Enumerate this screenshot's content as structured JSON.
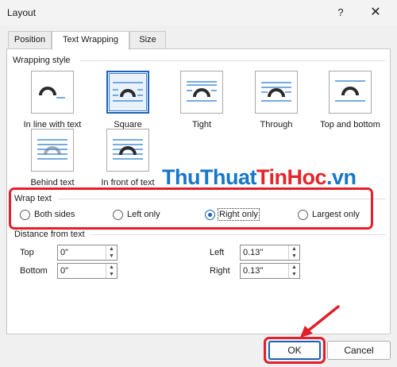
{
  "window": {
    "title": "Layout",
    "help_label": "?",
    "close_label": "✕"
  },
  "tabs": [
    {
      "label": "Position"
    },
    {
      "label": "Text Wrapping"
    },
    {
      "label": "Size"
    }
  ],
  "wrapping_style": {
    "label": "Wrapping style",
    "options": [
      {
        "label": "In line with text",
        "icon": "in-line-with-text-icon"
      },
      {
        "label": "Square",
        "icon": "square-wrap-icon"
      },
      {
        "label": "Tight",
        "icon": "tight-wrap-icon"
      },
      {
        "label": "Through",
        "icon": "through-wrap-icon"
      },
      {
        "label": "Top and bottom",
        "icon": "top-and-bottom-wrap-icon"
      },
      {
        "label": "Behind text",
        "icon": "behind-text-icon"
      },
      {
        "label": "In front of text",
        "icon": "in-front-of-text-icon"
      }
    ],
    "selected": "Square"
  },
  "wrap_text": {
    "label": "Wrap text",
    "options": [
      {
        "label": "Both sides"
      },
      {
        "label": "Left only"
      },
      {
        "label": "Right only"
      },
      {
        "label": "Largest only"
      }
    ],
    "selected": "Right only"
  },
  "distance": {
    "label": "Distance from text",
    "top": {
      "label": "Top",
      "value": "0\""
    },
    "bottom": {
      "label": "Bottom",
      "value": "0\""
    },
    "left": {
      "label": "Left",
      "value": "0.13\""
    },
    "right": {
      "label": "Right",
      "value": "0.13\""
    }
  },
  "buttons": {
    "ok": "OK",
    "cancel": "Cancel"
  },
  "watermark": {
    "part1": "ThuThuat",
    "part2": "TinHoc",
    "part3": ".vn"
  },
  "colors": {
    "accent": "#1a63b8",
    "annotation": "#e0202a",
    "watermark_blue": "#1677c8",
    "watermark_red": "#e4252b"
  }
}
